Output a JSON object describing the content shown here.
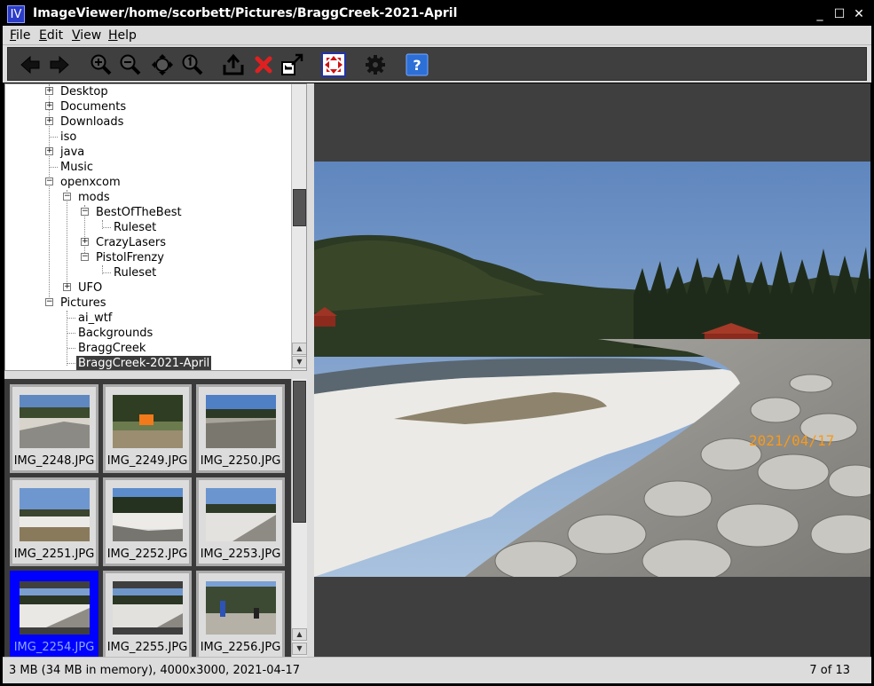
{
  "window": {
    "app_icon": "IV",
    "title": "ImageViewer/home/scorbett/Pictures/BraggCreek-2021-April",
    "minimize": "_",
    "maximize": "☐",
    "close": "✕"
  },
  "menubar": {
    "items": [
      {
        "key": "F",
        "rest": "ile"
      },
      {
        "key": "E",
        "rest": "dit"
      },
      {
        "key": "V",
        "rest": "iew"
      },
      {
        "key": "H",
        "rest": "elp"
      }
    ]
  },
  "toolbar": {
    "icons": [
      "back-arrow-icon",
      "forward-arrow-icon",
      "zoom-in-icon",
      "zoom-out-icon",
      "fit-window-icon",
      "zoom-actual-icon",
      "export-icon",
      "delete-icon",
      "move-icon",
      "fullscreen-icon",
      "settings-gear-icon",
      "help-icon"
    ],
    "help_label": "?",
    "colors": {
      "background": "#3f3f3f",
      "delete": "#e02020",
      "help_bg": "#2c6fd6",
      "fullscreen_arrows": "#d01010"
    }
  },
  "tree": {
    "items": [
      {
        "label": "Desktop",
        "expander": "+"
      },
      {
        "label": "Documents",
        "expander": "+"
      },
      {
        "label": "Downloads",
        "expander": "+"
      },
      {
        "label": "iso",
        "expander": ""
      },
      {
        "label": "java",
        "expander": "+"
      },
      {
        "label": "Music",
        "expander": ""
      },
      {
        "label": "openxcom",
        "expander": "−"
      },
      {
        "label": "mods",
        "expander": "−"
      },
      {
        "label": "BestOfTheBest",
        "expander": "−"
      },
      {
        "label": "Ruleset",
        "expander": ""
      },
      {
        "label": "CrazyLasers",
        "expander": "+"
      },
      {
        "label": "PistolFrenzy",
        "expander": "−"
      },
      {
        "label": "Ruleset",
        "expander": ""
      },
      {
        "label": "UFO",
        "expander": "+"
      },
      {
        "label": "Pictures",
        "expander": "−"
      },
      {
        "label": "ai_wtf",
        "expander": ""
      },
      {
        "label": "Backgrounds",
        "expander": ""
      },
      {
        "label": "BraggCreek",
        "expander": ""
      },
      {
        "label": "BraggCreek-2021-April",
        "expander": "",
        "selected": true
      }
    ]
  },
  "thumbnails": {
    "items": [
      {
        "name": "IMG_2248.JPG"
      },
      {
        "name": "IMG_2249.JPG"
      },
      {
        "name": "IMG_2250.JPG"
      },
      {
        "name": "IMG_2251.JPG"
      },
      {
        "name": "IMG_2252.JPG"
      },
      {
        "name": "IMG_2253.JPG"
      },
      {
        "name": "IMG_2254.JPG",
        "selected": true
      },
      {
        "name": "IMG_2255.JPG"
      },
      {
        "name": "IMG_2256.JPG"
      }
    ],
    "selection_color": "#0000ff"
  },
  "viewer": {
    "photo_date_stamp": "2021/04/17",
    "date_stamp_color": "#f59a1c"
  },
  "statusbar": {
    "info": "3 MB (34 MB in memory), 4000x3000, 2021-04-17",
    "position": "7 of 13"
  }
}
